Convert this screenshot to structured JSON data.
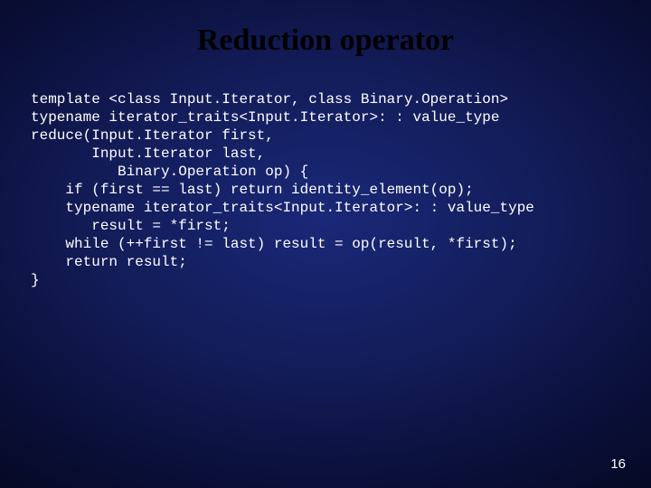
{
  "slide": {
    "title": "Reduction operator",
    "code": "template <class Input.Iterator, class Binary.Operation>\ntypename iterator_traits<Input.Iterator>: : value_type\nreduce(Input.Iterator first,\n       Input.Iterator last,\n          Binary.Operation op) {\n    if (first == last) return identity_element(op);\n    typename iterator_traits<Input.Iterator>: : value_type\n       result = *first;\n    while (++first != last) result = op(result, *first);\n    return result;\n}",
    "page_number": "16"
  }
}
